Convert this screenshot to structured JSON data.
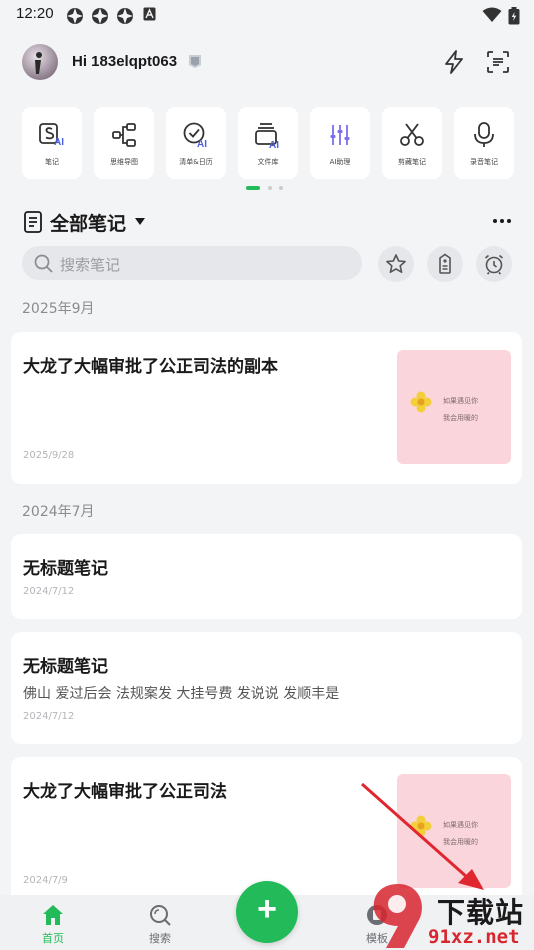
{
  "status_bar": {
    "time": "12:20"
  },
  "header": {
    "greeting": "Hi 183elqpt063"
  },
  "tools": [
    {
      "label": "笔记",
      "icon": "note-ai-icon"
    },
    {
      "label": "思维导图",
      "icon": "mindmap-icon"
    },
    {
      "label": "清单&日历",
      "icon": "checklist-ai-icon"
    },
    {
      "label": "文件库",
      "icon": "file-library-ai-icon"
    },
    {
      "label": "AI助理",
      "icon": "ai-assistant-icon"
    },
    {
      "label": "剪藏笔记",
      "icon": "scissors-icon"
    },
    {
      "label": "录音笔记",
      "icon": "microphone-icon"
    }
  ],
  "notes_section": {
    "title": "全部笔记"
  },
  "search": {
    "placeholder": "搜索笔记"
  },
  "groups": [
    {
      "label": "2025年9月"
    },
    {
      "label": "2024年7月"
    }
  ],
  "notes": [
    {
      "title": "大龙了大幅审批了公正司法的副本",
      "body": "",
      "date": "2025/9/28",
      "thumb_lines": [
        "如果遇见你",
        "我会用暖的"
      ]
    },
    {
      "title": "无标题笔记",
      "body": "",
      "date": "2024/7/12"
    },
    {
      "title": "无标题笔记",
      "body": "佛山 爱过后会 法规案发 大挂号费 发说说 发顺丰是",
      "date": "2024/7/12"
    },
    {
      "title": "大龙了大幅审批了公正司法",
      "body": "",
      "date": "2024/7/9",
      "thumb_lines": [
        "如果遇见你",
        "我会用暖的"
      ]
    }
  ],
  "tabbar": [
    {
      "label": "首页",
      "icon": "home-icon",
      "active": true
    },
    {
      "label": "搜索",
      "icon": "search-icon",
      "active": false
    },
    {
      "label": "模板",
      "icon": "template-icon",
      "active": false
    }
  ],
  "watermark": {
    "name": "下载站",
    "url": "91xz.net"
  },
  "colors": {
    "accent": "#23bb5a",
    "ai_badge": "#4d5fe0",
    "background": "#f3f4f6"
  }
}
